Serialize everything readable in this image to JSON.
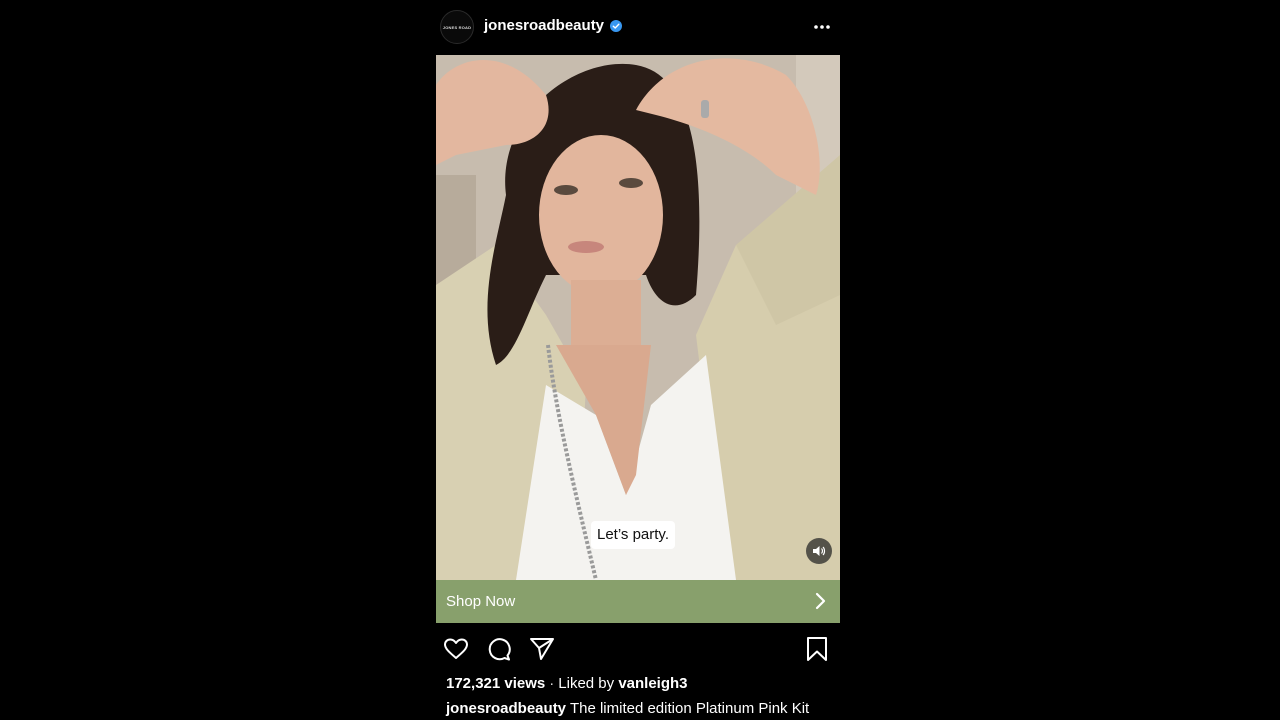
{
  "post": {
    "avatar_text": "JONES ROAD",
    "username": "jonesroadbeauty",
    "verified": true,
    "more_icon": "more-horizontal-icon"
  },
  "media": {
    "overlay_caption": "Let’s party.",
    "audio_icon": "speaker-icon"
  },
  "cta": {
    "label": "Shop Now",
    "icon": "chevron-right-icon",
    "color": "#88a06c"
  },
  "actions": {
    "like_icon": "heart-icon",
    "comment_icon": "comment-icon",
    "share_icon": "send-icon",
    "save_icon": "bookmark-icon"
  },
  "stats": {
    "views": "172,321 views",
    "separator": "·",
    "liked_by_prefix": "Liked by",
    "liked_by_user": "vanleigh3"
  },
  "caption": {
    "username": "jonesroadbeauty",
    "text": "The limited edition Platinum Pink Kit"
  },
  "colors": {
    "background": "#000000",
    "verified_badge": "#3897f0",
    "text": "#ffffff"
  }
}
